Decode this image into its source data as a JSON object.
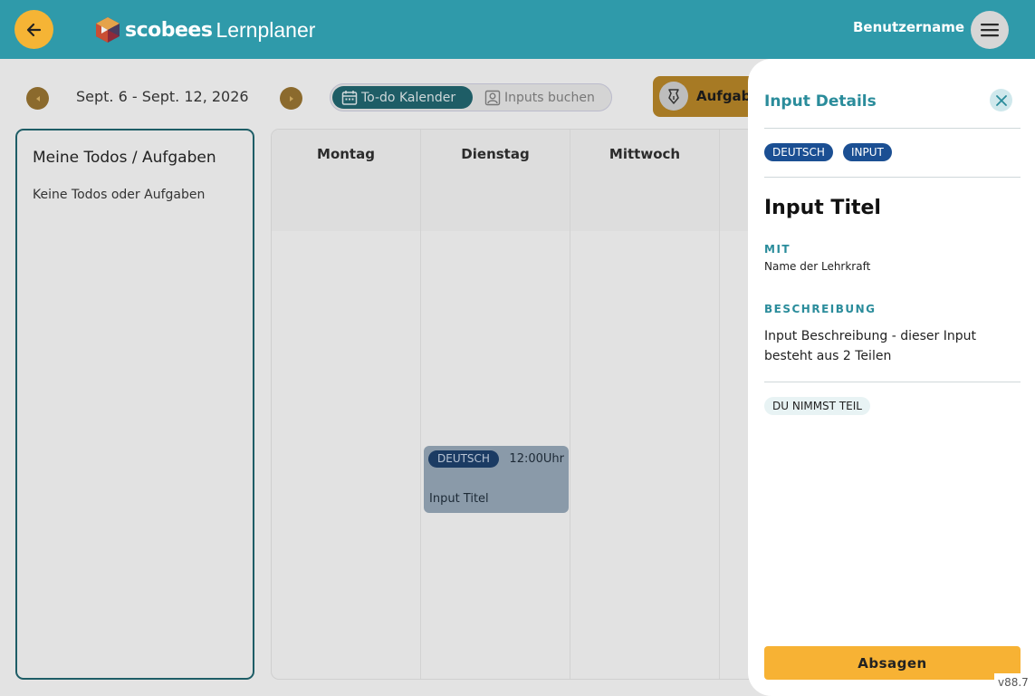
{
  "header": {
    "brand": "scobees",
    "product": "Lernplaner",
    "username": "Benutzername"
  },
  "toolbar": {
    "date_range": "Sept. 6 - Sept. 12, 2026",
    "view_todo": "To-do Kalender",
    "view_inputs": "Inputs buchen",
    "aufgabe_label": "Aufgabe"
  },
  "todos": {
    "title": "Meine Todos / Aufgaben",
    "empty": "Keine Todos oder Aufgaben"
  },
  "calendar": {
    "days": [
      "Montag",
      "Dienstag",
      "Mittwoch"
    ],
    "event": {
      "subject": "DEUTSCH",
      "time": "12:00Uhr",
      "title": "Input Titel"
    }
  },
  "details": {
    "panel_title": "Input Details",
    "tags": [
      "DEUTSCH",
      "INPUT"
    ],
    "title": "Input Titel",
    "with_label": "MIT",
    "teacher": "Name der Lehrkraft",
    "desc_label": "BESCHREIBUNG",
    "description": "Input Beschreibung - dieser Input besteht aus 2 Teilen",
    "status": "DU NIMMST TEIL",
    "cancel_label": "Absagen"
  },
  "version": "v88.7",
  "colors": {
    "header": "#2f9aaa",
    "accent": "#f5b435",
    "teal_dark": "#1e5d66",
    "tag_blue": "#1b4f93"
  }
}
